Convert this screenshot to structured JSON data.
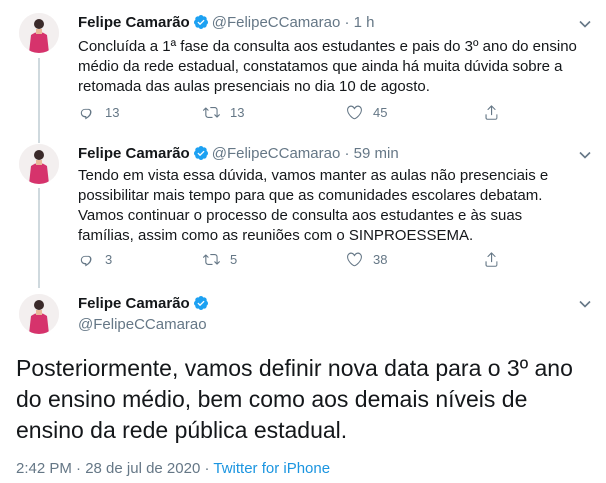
{
  "colors": {
    "accent": "#1da1f2",
    "link": "#1b95e0",
    "muted": "#657786"
  },
  "tweets": [
    {
      "name": "Felipe Camarão",
      "handle": "@FelipeCCamarao",
      "dot": "·",
      "time": "1 h",
      "text": "Concluída a 1ª fase da consulta aos estudantes e pais do 3º ano do ensino médio da rede estadual, constatamos que ainda há muita dúvida sobre a retomada das aulas presenciais no dia 10 de agosto.",
      "replies": "13",
      "retweets": "13",
      "likes": "45"
    },
    {
      "name": "Felipe Camarão",
      "handle": "@FelipeCCamarao",
      "dot": "·",
      "time": "59 min",
      "text": "Tendo em vista essa dúvida, vamos manter as aulas não presenciais e possibilitar mais tempo para que as comunidades escolares debatam. Vamos continuar o processo de consulta aos estudantes e às suas famílias, assim como as reuniões com o SINPROESSEMA.",
      "replies": "3",
      "retweets": "5",
      "likes": "38"
    }
  ],
  "main": {
    "name": "Felipe Camarão",
    "handle": "@FelipeCCamarao",
    "text": "Posteriormente, vamos definir nova data para o 3º ano do ensino médio, bem como aos demais níveis de ensino da rede pública estadual.",
    "timestamp": "2:42 PM · 28 de jul de 2020 · ",
    "source": "Twitter for iPhone"
  },
  "icons": {
    "verified": "verified-badge-icon",
    "chevron": "chevron-down-icon",
    "reply": "reply-icon",
    "retweet": "retweet-icon",
    "like": "heart-icon",
    "share": "share-icon"
  }
}
